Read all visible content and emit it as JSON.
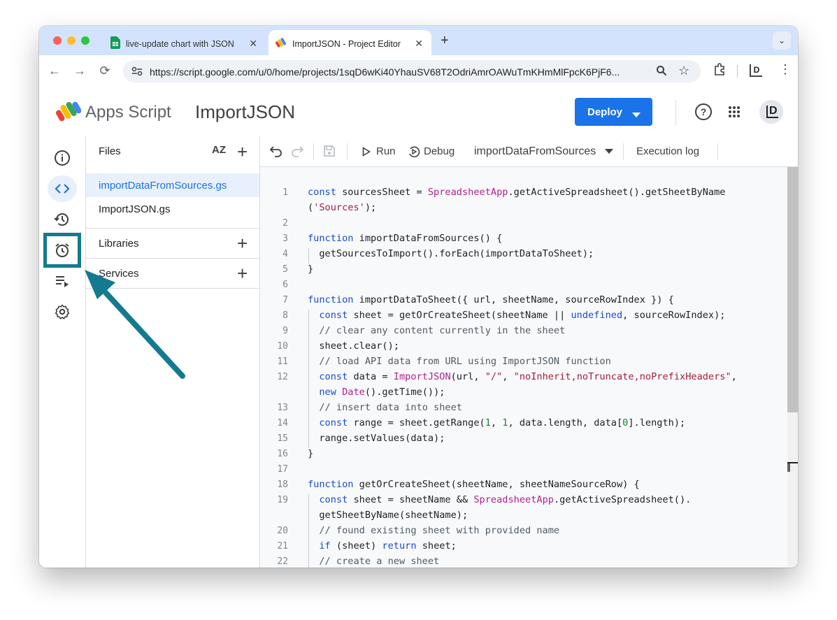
{
  "browser": {
    "tabs": [
      {
        "title": "live-update chart with JSON",
        "icon": "sheets-icon",
        "active": false
      },
      {
        "title": "ImportJSON - Project Editor",
        "icon": "apps-script-icon",
        "active": true
      }
    ],
    "url": "https://script.google.com/u/0/home/projects/1sqD6wKi40YhauSV68T2OdriAmrOAWuTmKHmMlFpcK6PjF6...",
    "profile_initial": "D"
  },
  "app": {
    "name": "Apps Script",
    "project": "ImportJSON",
    "deploy_label": "Deploy",
    "avatar_initial": "D"
  },
  "rail": {
    "items": [
      "overview-icon",
      "editor-icon",
      "executions-icon",
      "triggers-icon",
      "executions-log-icon",
      "settings-icon"
    ],
    "active": "editor-icon",
    "highlighted": "triggers-icon",
    "highlight_color": "#137a8f"
  },
  "files": {
    "header": "Files",
    "sort_label": "AZ",
    "items": [
      "importDataFromSources.gs",
      "ImportJSON.gs"
    ],
    "selected": "importDataFromSources.gs",
    "sections": [
      "Libraries",
      "Services"
    ]
  },
  "editor_toolbar": {
    "run": "Run",
    "debug": "Debug",
    "function": "importDataFromSources",
    "log": "Execution log"
  },
  "code": {
    "lines": [
      {
        "n": "1",
        "html": "<span class=\"k\">const</span> sourcesSheet = <span class=\"m\">SpreadsheetApp</span>.getActiveSpreadsheet().getSheetByName"
      },
      {
        "n": "",
        "html": "(<span class=\"s\">'Sources'</span>);"
      },
      {
        "n": "2",
        "html": ""
      },
      {
        "n": "3",
        "html": "<span class=\"k\">function</span> importDataFromSources() {"
      },
      {
        "n": "4",
        "html": "  getSourcesToImport().forEach(importDataToSheet);"
      },
      {
        "n": "5",
        "html": "}"
      },
      {
        "n": "6",
        "html": ""
      },
      {
        "n": "7",
        "html": "<span class=\"k\">function</span> importDataToSheet({ url, sheetName, sourceRowIndex }) {"
      },
      {
        "n": "8",
        "html": "  <span class=\"k\">const</span> sheet = getOrCreateSheet(sheetName || <span class=\"k\">undefined</span>, sourceRowIndex);"
      },
      {
        "n": "9",
        "html": "  <span class=\"c\">// clear any content currently in the sheet</span>"
      },
      {
        "n": "10",
        "html": "  sheet.clear();"
      },
      {
        "n": "11",
        "html": "  <span class=\"c\">// load API data from URL using ImportJSON function</span>"
      },
      {
        "n": "12",
        "html": "  <span class=\"k\">const</span> data = <span class=\"m\">ImportJSON</span>(url, <span class=\"s\">\"/\"</span>, <span class=\"s\">\"noInherit,noTruncate,noPrefixHeaders\"</span>,"
      },
      {
        "n": "",
        "html": "  <span class=\"k\">new</span> <span class=\"m\">Date</span>().getTime());"
      },
      {
        "n": "13",
        "html": "  <span class=\"c\">// insert data into sheet</span>"
      },
      {
        "n": "14",
        "html": "  <span class=\"k\">const</span> range = sheet.getRange(<span class=\"nm\">1</span>, <span class=\"nm\">1</span>, data.length, data[<span class=\"nm\">0</span>].length);"
      },
      {
        "n": "15",
        "html": "  range.setValues(data);"
      },
      {
        "n": "16",
        "html": "}"
      },
      {
        "n": "17",
        "html": ""
      },
      {
        "n": "18",
        "html": "<span class=\"k\">function</span> getOrCreateSheet(sheetName, sheetNameSourceRow) {"
      },
      {
        "n": "19",
        "html": "  <span class=\"k\">const</span> sheet = sheetName &amp;&amp; <span class=\"m\">SpreadsheetApp</span>.getActiveSpreadsheet()."
      },
      {
        "n": "",
        "html": "  getSheetByName(sheetName);"
      },
      {
        "n": "20",
        "html": "  <span class=\"c\">// found existing sheet with provided name</span>"
      },
      {
        "n": "21",
        "html": "  <span class=\"k\">if</span> (sheet) <span class=\"k\">return</span> sheet;"
      },
      {
        "n": "22",
        "html": "  <span class=\"c\">// create a new sheet</span>"
      }
    ]
  }
}
